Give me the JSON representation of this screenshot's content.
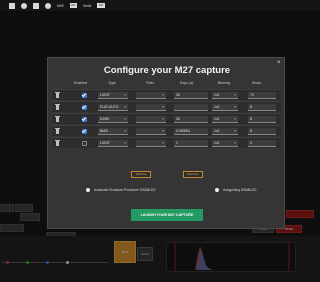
{
  "topbar": {
    "label_1": "M89",
    "chip_1": "HD",
    "label_2": "Stella",
    "chip_2": "HD"
  },
  "modal": {
    "title": "Configure your M27 capture",
    "close_label": "×",
    "columns": [
      "Enabled",
      "Type",
      "Filter",
      "Expo (s)",
      "Binning",
      "Shots"
    ],
    "rows": [
      {
        "enabled": true,
        "type": "LIGHT",
        "filter": "",
        "expo": "30",
        "binning": "1x1",
        "shots": "70"
      },
      {
        "enabled": true,
        "type": "FLAT-AUTO",
        "filter": "",
        "expo": "",
        "binning": "1x1",
        "shots": "8"
      },
      {
        "enabled": true,
        "type": "DARK",
        "filter": "",
        "expo": "30",
        "binning": "1x1",
        "shots": "8"
      },
      {
        "enabled": true,
        "type": "BIAS",
        "filter": "",
        "expo": "0.000001",
        "binning": "1x1",
        "shots": "8"
      },
      {
        "enabled": false,
        "type": "LIGHT",
        "filter": "",
        "expo": "1",
        "binning": "1x1",
        "shots": "0"
      }
    ],
    "add_label": "Add line",
    "remove_label": "Remove",
    "option_1": "Automatic Shutdown Procedure DISABLED",
    "option_2": "Autoguiding DISABLED",
    "launch_label": "LAUNCH YOUR M27 CAPTURE"
  },
  "bottom": {
    "tile_label": "IDLE",
    "reset_label": "Reset",
    "red_label": "STOP",
    "zoom_label": "+ Pix"
  },
  "colors": {
    "accent_orange": "#c8872a",
    "checkbox_blue": "#3a7bd5",
    "launch_green": "#239c63",
    "danger_red": "#8e1b1b"
  }
}
